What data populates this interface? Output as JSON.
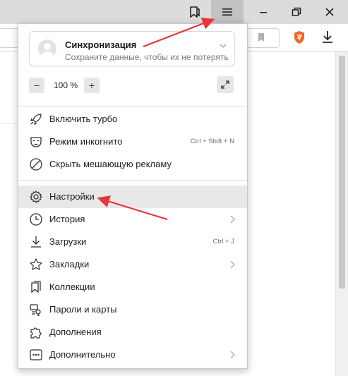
{
  "menu": {
    "sync": {
      "title": "Синхронизация",
      "subtitle": "Сохраните данные, чтобы их не потерять"
    },
    "zoom": {
      "minus": "−",
      "value": "100 %",
      "plus": "+"
    },
    "items": [
      {
        "label": "Включить турбо",
        "icon": "rocket-icon"
      },
      {
        "label": "Режим инкогнито",
        "icon": "incognito-mask-icon",
        "shortcut": "Ctrl + Shift + N"
      },
      {
        "label": "Скрыть мешающую рекламу",
        "icon": "block-ads-icon"
      },
      {
        "label": "Настройки",
        "icon": "gear-icon"
      },
      {
        "label": "История",
        "icon": "clock-icon",
        "submenu": true
      },
      {
        "label": "Загрузки",
        "icon": "download-icon",
        "shortcut": "Ctrl + J"
      },
      {
        "label": "Закладки",
        "icon": "star-icon",
        "submenu": true
      },
      {
        "label": "Коллекции",
        "icon": "collections-bookmark-icon"
      },
      {
        "label": "Пароли и карты",
        "icon": "key-card-icon"
      },
      {
        "label": "Дополнения",
        "icon": "puzzle-icon"
      },
      {
        "label": "Дополнительно",
        "icon": "more-dots-icon",
        "submenu": true
      }
    ]
  },
  "colors": {
    "annotation_arrow": "#e8343a",
    "titlebar": "#dcdcdc",
    "hover": "#e8e8e8",
    "brand_shield": "#f26522"
  }
}
